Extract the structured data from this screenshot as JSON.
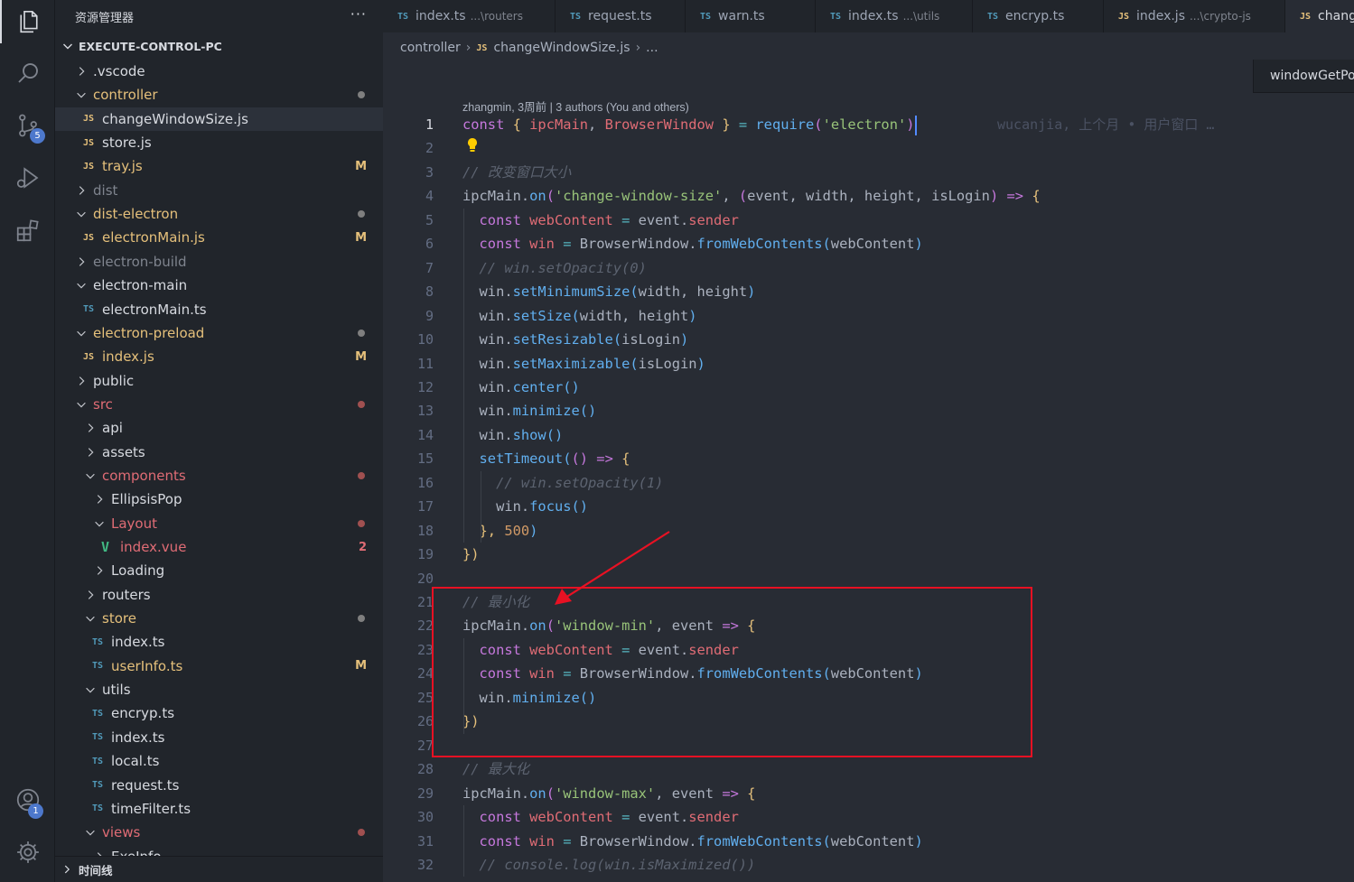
{
  "sidebar": {
    "title": "资源管理器",
    "more": "···",
    "project": "EXECUTE-CONTROL-PC",
    "bottom_section": "时间线",
    "badges": {
      "scm": "5",
      "accounts": "1"
    },
    "items": [
      {
        "label": ".vscode",
        "kind": "folder",
        "open": false,
        "depth": 0,
        "color": "#d7dae0"
      },
      {
        "label": "controller",
        "kind": "folder",
        "open": true,
        "depth": 0,
        "color": "#e5c07b",
        "dot": "#7f7f7f"
      },
      {
        "label": "changeWindowSize.js",
        "kind": "js",
        "depth": 1,
        "color": "#d7dae0",
        "selected": true
      },
      {
        "label": "store.js",
        "kind": "js",
        "depth": 1,
        "color": "#d7dae0"
      },
      {
        "label": "tray.js",
        "kind": "js",
        "depth": 1,
        "color": "#e5c07b",
        "deco": "M"
      },
      {
        "label": "dist",
        "kind": "folder",
        "open": false,
        "depth": 0,
        "color": "#7f848e"
      },
      {
        "label": "dist-electron",
        "kind": "folder",
        "open": true,
        "depth": 0,
        "color": "#e5c07b",
        "dot": "#7f7f7f"
      },
      {
        "label": "electronMain.js",
        "kind": "js",
        "depth": 1,
        "color": "#e5c07b",
        "deco": "M"
      },
      {
        "label": "electron-build",
        "kind": "folder",
        "open": false,
        "depth": 0,
        "color": "#7f848e"
      },
      {
        "label": "electron-main",
        "kind": "folder",
        "open": true,
        "depth": 0,
        "color": "#d7dae0"
      },
      {
        "label": "electronMain.ts",
        "kind": "ts",
        "depth": 1,
        "color": "#d7dae0"
      },
      {
        "label": "electron-preload",
        "kind": "folder",
        "open": true,
        "depth": 0,
        "color": "#e5c07b",
        "dot": "#7f7f7f"
      },
      {
        "label": "index.js",
        "kind": "js",
        "depth": 1,
        "color": "#e5c07b",
        "deco": "M"
      },
      {
        "label": "public",
        "kind": "folder",
        "open": false,
        "depth": 0,
        "color": "#d7dae0"
      },
      {
        "label": "src",
        "kind": "folder",
        "open": true,
        "depth": 0,
        "color": "#e06c75",
        "dot": "#a05050"
      },
      {
        "label": "api",
        "kind": "folder",
        "open": false,
        "depth": 1,
        "color": "#d7dae0"
      },
      {
        "label": "assets",
        "kind": "folder",
        "open": false,
        "depth": 1,
        "color": "#d7dae0"
      },
      {
        "label": "components",
        "kind": "folder",
        "open": true,
        "depth": 1,
        "color": "#e06c75",
        "dot": "#a05050"
      },
      {
        "label": "EllipsisPop",
        "kind": "folder",
        "open": false,
        "depth": 2,
        "color": "#d7dae0"
      },
      {
        "label": "Layout",
        "kind": "folder",
        "open": true,
        "depth": 2,
        "color": "#e06c75",
        "dot": "#a05050"
      },
      {
        "label": "index.vue",
        "kind": "vue",
        "depth": 3,
        "color": "#e06c75",
        "deco": "2"
      },
      {
        "label": "Loading",
        "kind": "folder",
        "open": false,
        "depth": 2,
        "color": "#d7dae0"
      },
      {
        "label": "routers",
        "kind": "folder",
        "open": false,
        "depth": 1,
        "color": "#d7dae0"
      },
      {
        "label": "store",
        "kind": "folder",
        "open": true,
        "depth": 1,
        "color": "#e5c07b",
        "dot": "#7f7f7f"
      },
      {
        "label": "index.ts",
        "kind": "ts",
        "depth": 2,
        "color": "#d7dae0"
      },
      {
        "label": "userInfo.ts",
        "kind": "ts",
        "depth": 2,
        "color": "#e5c07b",
        "deco": "M"
      },
      {
        "label": "utils",
        "kind": "folder",
        "open": true,
        "depth": 1,
        "color": "#d7dae0"
      },
      {
        "label": "encryp.ts",
        "kind": "ts",
        "depth": 2,
        "color": "#d7dae0"
      },
      {
        "label": "index.ts",
        "kind": "ts",
        "depth": 2,
        "color": "#d7dae0"
      },
      {
        "label": "local.ts",
        "kind": "ts",
        "depth": 2,
        "color": "#d7dae0"
      },
      {
        "label": "request.ts",
        "kind": "ts",
        "depth": 2,
        "color": "#d7dae0"
      },
      {
        "label": "timeFilter.ts",
        "kind": "ts",
        "depth": 2,
        "color": "#d7dae0"
      },
      {
        "label": "views",
        "kind": "folder",
        "open": true,
        "depth": 1,
        "color": "#e06c75",
        "dot": "#a05050"
      },
      {
        "label": "ExeInfo",
        "kind": "folder",
        "open": false,
        "depth": 2,
        "color": "#d7dae0"
      }
    ]
  },
  "tabs": [
    {
      "type": "TS",
      "label": "index.ts",
      "desc": "...\\routers"
    },
    {
      "type": "TS",
      "label": "request.ts",
      "desc": ""
    },
    {
      "type": "TS",
      "label": "warn.ts",
      "desc": ""
    },
    {
      "type": "TS",
      "label": "index.ts",
      "desc": "...\\utils"
    },
    {
      "type": "TS",
      "label": "encryp.ts",
      "desc": ""
    },
    {
      "type": "JS",
      "label": "index.js",
      "desc": "...\\crypto-js"
    },
    {
      "type": "JS",
      "label": "changeWindowSize.js",
      "desc": "",
      "active": true
    }
  ],
  "breadcrumb": {
    "folder": "controller",
    "file": "changeWindowSize.js",
    "tail": "..."
  },
  "sticky": {
    "label": "windowGetPosition"
  },
  "editor": {
    "codelens": "zhangmin, 3周前 | 3 authors (You and others)",
    "blame_line1": "wucanjia, 上个月 • 用户窗口 …",
    "lines": [
      [
        [
          "const ",
          "k"
        ],
        [
          "{ ",
          "p"
        ],
        [
          "ipcMain",
          "v"
        ],
        [
          ", ",
          ""
        ],
        [
          "BrowserWindow",
          "v"
        ],
        [
          " } ",
          "p"
        ],
        [
          "= ",
          "o"
        ],
        [
          "require",
          "fn"
        ],
        [
          "(",
          "k"
        ],
        [
          "'electron'",
          "s"
        ],
        [
          ")",
          "k"
        ]
      ],
      [],
      [
        [
          "// 改变窗口大小",
          "c"
        ]
      ],
      [
        [
          "ipcMain",
          ""
        ],
        [
          ".",
          ""
        ],
        [
          "on",
          "fn"
        ],
        [
          "(",
          "k"
        ],
        [
          "'change-window-size'",
          "s"
        ],
        [
          ", ",
          ""
        ],
        [
          "(",
          "k"
        ],
        [
          "event",
          ""
        ],
        [
          ", ",
          ""
        ],
        [
          "width",
          ""
        ],
        [
          ", ",
          ""
        ],
        [
          "height",
          ""
        ],
        [
          ", ",
          ""
        ],
        [
          "isLogin",
          ""
        ],
        [
          ")",
          "k"
        ],
        [
          " => ",
          "k"
        ],
        [
          "{",
          "p"
        ]
      ],
      [
        [
          "  const ",
          "k"
        ],
        [
          "webContent",
          "v"
        ],
        [
          " = ",
          "o"
        ],
        [
          "event",
          ""
        ],
        [
          ".",
          ""
        ],
        [
          "sender",
          "v"
        ]
      ],
      [
        [
          "  const ",
          "k"
        ],
        [
          "win",
          "v"
        ],
        [
          " = ",
          "o"
        ],
        [
          "BrowserWindow",
          ""
        ],
        [
          ".",
          ""
        ],
        [
          "fromWebContents",
          "fn"
        ],
        [
          "(",
          "fn"
        ],
        [
          "webContent",
          ""
        ],
        [
          ")",
          "fn"
        ]
      ],
      [
        [
          "  // win.setOpacity(0)",
          "c"
        ]
      ],
      [
        [
          "  win",
          ""
        ],
        [
          ".",
          ""
        ],
        [
          "setMinimumSize",
          "fn"
        ],
        [
          "(",
          "fn"
        ],
        [
          "width",
          ""
        ],
        [
          ", ",
          ""
        ],
        [
          "height",
          ""
        ],
        [
          ")",
          "fn"
        ]
      ],
      [
        [
          "  win",
          ""
        ],
        [
          ".",
          ""
        ],
        [
          "setSize",
          "fn"
        ],
        [
          "(",
          "fn"
        ],
        [
          "width",
          ""
        ],
        [
          ", ",
          ""
        ],
        [
          "height",
          ""
        ],
        [
          ")",
          "fn"
        ]
      ],
      [
        [
          "  win",
          ""
        ],
        [
          ".",
          ""
        ],
        [
          "setResizable",
          "fn"
        ],
        [
          "(",
          "fn"
        ],
        [
          "isLogin",
          ""
        ],
        [
          ")",
          "fn"
        ]
      ],
      [
        [
          "  win",
          ""
        ],
        [
          ".",
          ""
        ],
        [
          "setMaximizable",
          "fn"
        ],
        [
          "(",
          "fn"
        ],
        [
          "isLogin",
          ""
        ],
        [
          ")",
          "fn"
        ]
      ],
      [
        [
          "  win",
          ""
        ],
        [
          ".",
          ""
        ],
        [
          "center",
          "fn"
        ],
        [
          "()",
          "fn"
        ]
      ],
      [
        [
          "  win",
          ""
        ],
        [
          ".",
          ""
        ],
        [
          "minimize",
          "fn"
        ],
        [
          "()",
          "fn"
        ]
      ],
      [
        [
          "  win",
          ""
        ],
        [
          ".",
          ""
        ],
        [
          "show",
          "fn"
        ],
        [
          "()",
          "fn"
        ]
      ],
      [
        [
          "  setTimeout",
          "fn"
        ],
        [
          "(",
          "fn"
        ],
        [
          "()",
          "k"
        ],
        [
          " => ",
          "k"
        ],
        [
          "{",
          "p"
        ]
      ],
      [
        [
          "    // win.setOpacity(1)",
          "c"
        ]
      ],
      [
        [
          "    win",
          ""
        ],
        [
          ".",
          ""
        ],
        [
          "focus",
          "fn"
        ],
        [
          "()",
          "fn"
        ]
      ],
      [
        [
          "  },",
          "p"
        ],
        [
          " ",
          ""
        ],
        [
          "500",
          "n"
        ],
        [
          ")",
          "fn"
        ]
      ],
      [
        [
          "})",
          "p"
        ]
      ],
      [],
      [
        [
          "// 最小化",
          "c"
        ]
      ],
      [
        [
          "ipcMain",
          ""
        ],
        [
          ".",
          ""
        ],
        [
          "on",
          "fn"
        ],
        [
          "(",
          "k"
        ],
        [
          "'window-min'",
          "s"
        ],
        [
          ", ",
          ""
        ],
        [
          "event",
          ""
        ],
        [
          " => ",
          "k"
        ],
        [
          "{",
          "p"
        ]
      ],
      [
        [
          "  const ",
          "k"
        ],
        [
          "webContent",
          "v"
        ],
        [
          " = ",
          "o"
        ],
        [
          "event",
          ""
        ],
        [
          ".",
          ""
        ],
        [
          "sender",
          "v"
        ]
      ],
      [
        [
          "  const ",
          "k"
        ],
        [
          "win",
          "v"
        ],
        [
          " = ",
          "o"
        ],
        [
          "BrowserWindow",
          ""
        ],
        [
          ".",
          ""
        ],
        [
          "fromWebContents",
          "fn"
        ],
        [
          "(",
          "fn"
        ],
        [
          "webContent",
          ""
        ],
        [
          ")",
          "fn"
        ]
      ],
      [
        [
          "  win",
          ""
        ],
        [
          ".",
          ""
        ],
        [
          "minimize",
          "fn"
        ],
        [
          "()",
          "fn"
        ]
      ],
      [
        [
          "})",
          "p"
        ]
      ],
      [],
      [
        [
          "// 最大化",
          "c"
        ]
      ],
      [
        [
          "ipcMain",
          ""
        ],
        [
          ".",
          ""
        ],
        [
          "on",
          "fn"
        ],
        [
          "(",
          "k"
        ],
        [
          "'window-max'",
          "s"
        ],
        [
          ", ",
          ""
        ],
        [
          "event",
          ""
        ],
        [
          " => ",
          "k"
        ],
        [
          "{",
          "p"
        ]
      ],
      [
        [
          "  const ",
          "k"
        ],
        [
          "webContent",
          "v"
        ],
        [
          " = ",
          "o"
        ],
        [
          "event",
          ""
        ],
        [
          ".",
          ""
        ],
        [
          "sender",
          "v"
        ]
      ],
      [
        [
          "  const ",
          "k"
        ],
        [
          "win",
          "v"
        ],
        [
          " = ",
          "o"
        ],
        [
          "BrowserWindow",
          ""
        ],
        [
          ".",
          ""
        ],
        [
          "fromWebContents",
          "fn"
        ],
        [
          "(",
          "fn"
        ],
        [
          "webContent",
          ""
        ],
        [
          ")",
          "fn"
        ]
      ],
      [
        [
          "  // console.log(win.isMaximized())",
          "c"
        ]
      ]
    ],
    "line_numbers": [
      "1",
      "2",
      "3",
      "4",
      "5",
      "6",
      "7",
      "8",
      "9",
      "10",
      "11",
      "12",
      "13",
      "14",
      "15",
      "16",
      "17",
      "18",
      "19",
      "20",
      "21",
      "22",
      "23",
      "24",
      "25",
      "26",
      "27",
      "28",
      "29",
      "30",
      "31",
      "32"
    ]
  },
  "colors": {
    "annotation": "#e81123",
    "accent": "#528bff"
  }
}
